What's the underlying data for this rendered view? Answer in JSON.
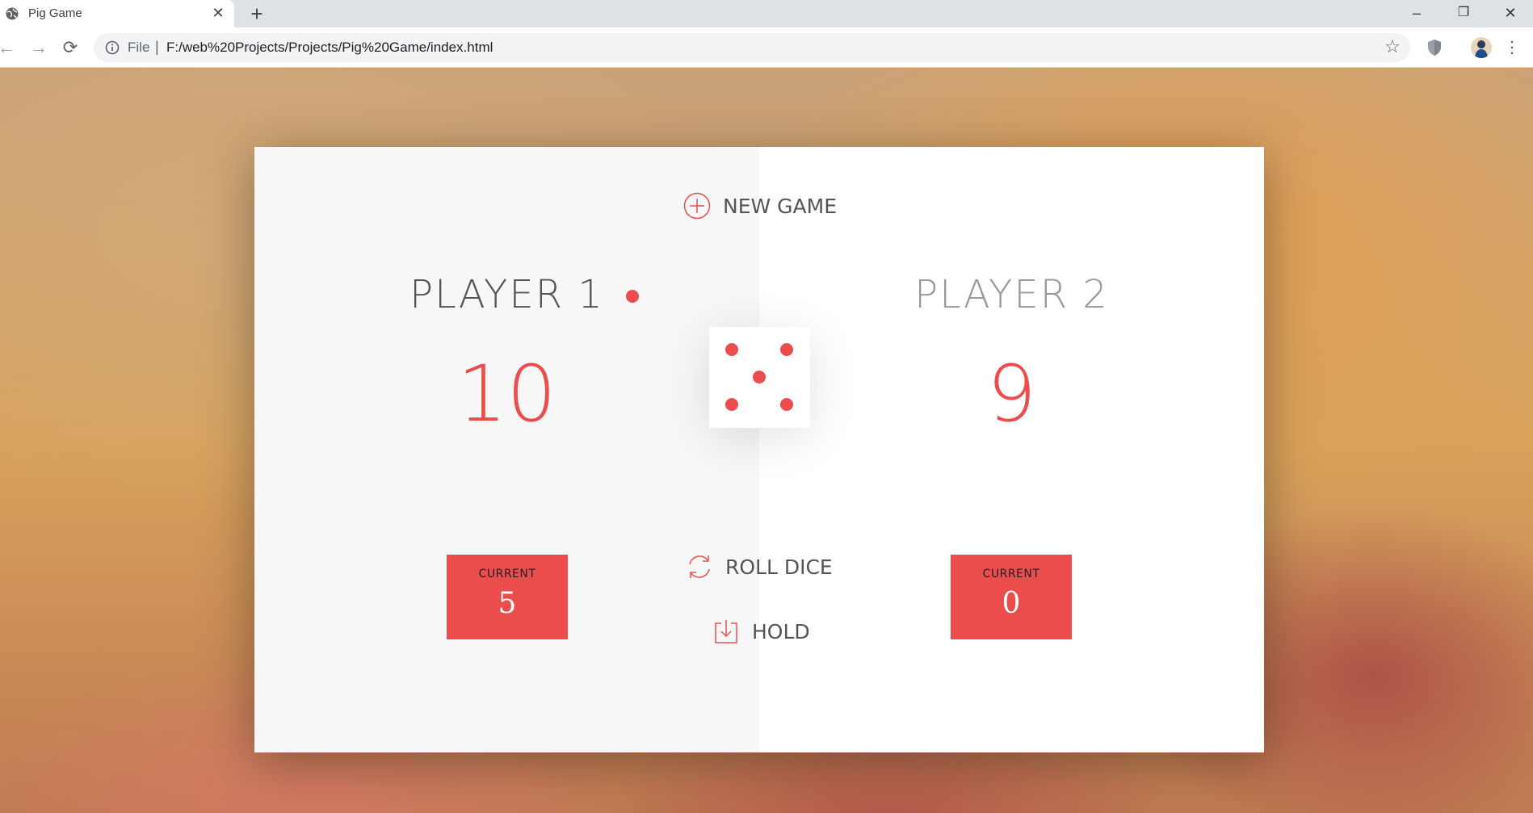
{
  "browser": {
    "tab_title": "Pig Game",
    "tab_close": "✕",
    "new_tab": "+",
    "window_controls": {
      "minimize": "–",
      "restore": "❐",
      "close": "✕"
    },
    "omnibox": {
      "scheme_label": "File",
      "separator": "|",
      "url": "F:/web%20Projects/Projects/Pig%20Game/index.html"
    },
    "nav": {
      "back": "←",
      "forward": "→",
      "reload": "⟳",
      "star": "☆",
      "menu": "⋮"
    }
  },
  "game": {
    "new_game_label": "NEW GAME",
    "roll_dice_label": "ROLL DICE",
    "hold_label": "HOLD",
    "dice_value": 5,
    "active_player": 1,
    "players": [
      {
        "name": "PLAYER 1",
        "score": "10",
        "current_label": "CURRENT",
        "current_score": "5"
      },
      {
        "name": "PLAYER 2",
        "score": "9",
        "current_label": "CURRENT",
        "current_score": "0"
      }
    ]
  },
  "colors": {
    "accent": "#eb4d4d",
    "panel_left": "#f7f7f7",
    "panel_right": "#ffffff"
  },
  "icons": {
    "favicon": "globe-icon",
    "new_game": "plus-circle-icon",
    "roll_dice": "refresh-icon",
    "hold": "download-icon",
    "security": "shield-icon",
    "info": "info-icon"
  }
}
